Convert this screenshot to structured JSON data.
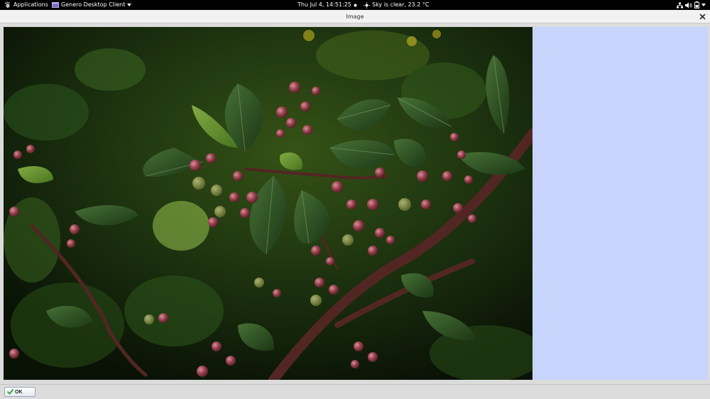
{
  "topbar": {
    "applications": "Applications",
    "app_name": "Genero Desktop Client",
    "clock": "Thu Jul  4, 14:51:25",
    "weather": "Sky is clear, 23.2 °C"
  },
  "window": {
    "title": "Image"
  },
  "buttons": {
    "ok": "OK"
  },
  "colors": {
    "topbar_bg": "#000000",
    "side_panel": "#c8d4fc",
    "window_bg": "#dcdcdc"
  },
  "icons": {
    "activities": "gnome-foot-icon",
    "app": "app-window-icon",
    "weather": "sun-icon",
    "network": "network-icon",
    "volume": "volume-icon",
    "battery": "battery-icon",
    "close": "close-icon",
    "ok": "checkmark-icon"
  }
}
